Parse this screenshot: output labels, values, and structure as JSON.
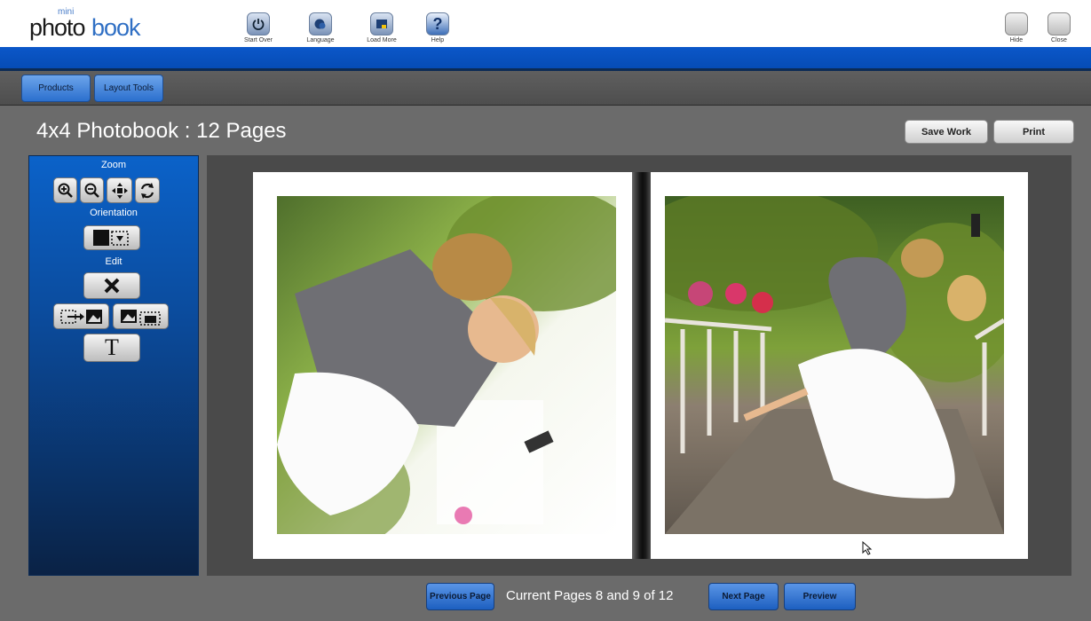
{
  "app": {
    "logo_small": "mini",
    "logo_main_dark": "photo",
    "logo_main_blue": "book"
  },
  "toolbar": {
    "start_over": "Start Over",
    "language": "Language",
    "load_more": "Load More",
    "help": "Help",
    "hide": "Hide",
    "close": "Close"
  },
  "tabs": {
    "products": "Products",
    "layout_tools": "Layout Tools"
  },
  "header": {
    "title": "4x4 Photobook : 12 Pages",
    "save_work": "Save Work",
    "print": "Print"
  },
  "tools": {
    "zoom": "Zoom",
    "orientation": "Orientation",
    "edit": "Edit",
    "text_tool": "T"
  },
  "navigation": {
    "previous_page": "Previous Page",
    "current_pages": "Current Pages 8 and 9 of 12",
    "next_page": "Next Page",
    "preview": "Preview"
  },
  "colors": {
    "accent_blue": "#0b57c9",
    "panel_blue": "#0b4a9a"
  },
  "icons": [
    "power-icon",
    "language-icon",
    "load-more-icon",
    "help-icon",
    "zoom-in-icon",
    "zoom-out-icon",
    "move-icon",
    "rotate-icon",
    "orientation-icon",
    "delete-icon",
    "replace-image-icon",
    "swap-image-icon",
    "text-tool-icon",
    "cursor-icon"
  ]
}
